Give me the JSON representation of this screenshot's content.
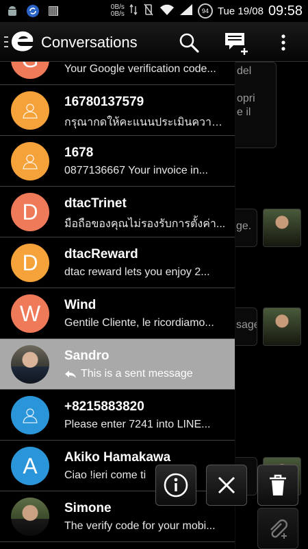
{
  "status_bar": {
    "speed_up": "0B/s",
    "speed_down": "0B/s",
    "battery": "94",
    "date": "Tue 19/08",
    "time": "09:58"
  },
  "action_bar": {
    "title": "Conversations",
    "icons": [
      "app-logo",
      "search",
      "new-message",
      "overflow-menu"
    ]
  },
  "background_thread": {
    "bubble_texts": [
      "del",
      "opri",
      "e il",
      "ge.",
      "sage"
    ]
  },
  "conversations": [
    {
      "name": "",
      "snippet": "Your Google verification code...",
      "avatar": "letter",
      "avatar_letter": "G",
      "avatar_color": "#ee7a5a"
    },
    {
      "name": "16780137579",
      "snippet": "กรุณากดให้คะแนนประเมินความพึงพอใจ",
      "avatar": "person",
      "avatar_color": "#f5a23a"
    },
    {
      "name": "1678",
      "snippet": " 0877136667 Your invoice in...",
      "avatar": "person",
      "avatar_color": "#f5a23a"
    },
    {
      "name": "dtacTrinet",
      "snippet": "มือถือของคุณไม่รองรับการตั้งค่า...",
      "avatar": "letter",
      "avatar_letter": "D",
      "avatar_color": "#ee7a5a"
    },
    {
      "name": "dtacReward",
      "snippet": "dtac reward lets you enjoy 2...",
      "avatar": "letter",
      "avatar_letter": "D",
      "avatar_color": "#f5a23a"
    },
    {
      "name": "Wind",
      "snippet": "Gentile Cliente, le ricordiamo...",
      "avatar": "letter",
      "avatar_letter": "W",
      "avatar_color": "#ee7a5a"
    },
    {
      "name": "Sandro",
      "snippet": "This is a sent message",
      "avatar": "photo",
      "selected": true,
      "sent": true
    },
    {
      "name": "+8215883820",
      "snippet": "Please enter 7241 into LINE...",
      "avatar": "person",
      "avatar_color": "#2b95d9"
    },
    {
      "name": "Akiko Hamakawa",
      "snippet": "Ciao !ieri come ti",
      "avatar": "letter",
      "avatar_letter": "A",
      "avatar_color": "#2b95d9"
    },
    {
      "name": "Simone",
      "snippet": "The verify code for your mobi...",
      "avatar": "photo"
    }
  ],
  "floating_actions": [
    "info",
    "close",
    "delete",
    "attach"
  ],
  "colors": {
    "selected_row": "#a9a9a9",
    "orange": "#f5a23a",
    "salmon": "#ee7a5a",
    "blue": "#2b95d9"
  }
}
